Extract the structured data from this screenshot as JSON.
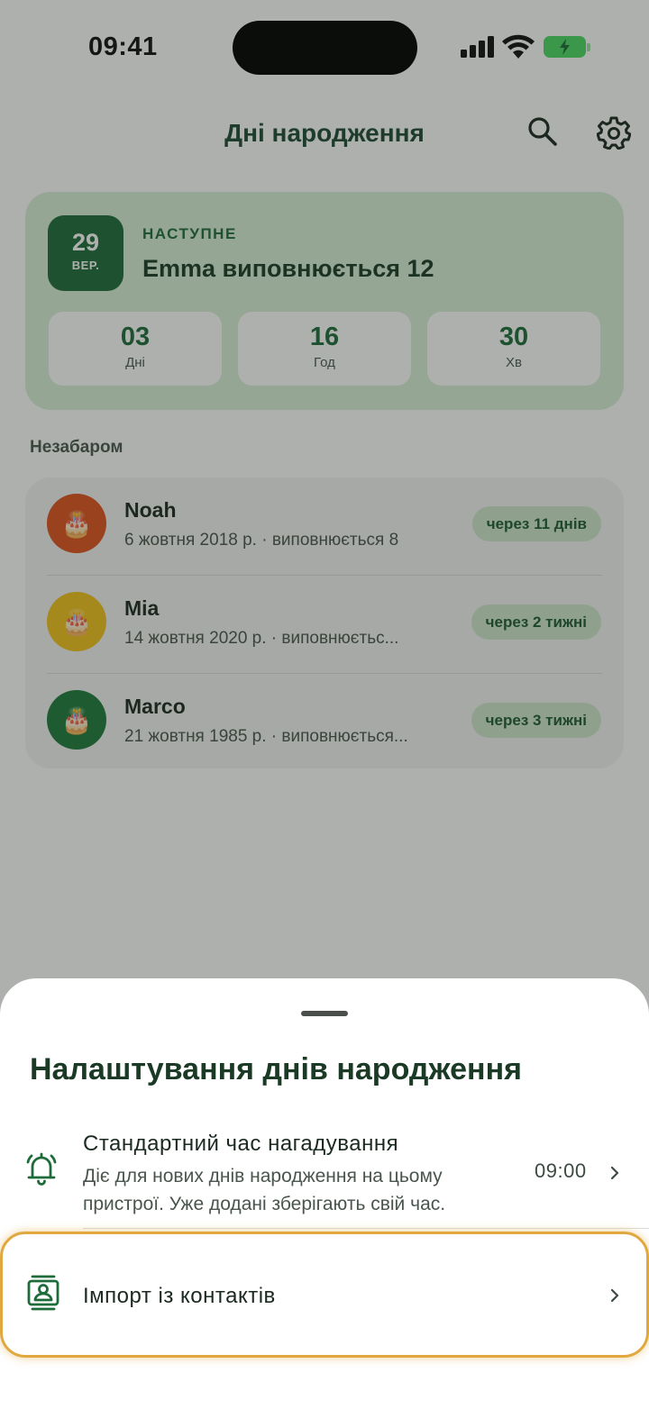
{
  "status_bar": {
    "time": "09:41"
  },
  "app_bar": {
    "title": "Дні народження"
  },
  "next_birthday": {
    "day": "29",
    "month": "ВЕР.",
    "label": "НАСТУПНЕ",
    "headline": "Emma виповнюється 12",
    "countdown": [
      {
        "value": "03",
        "unit": "Дні"
      },
      {
        "value": "16",
        "unit": "Год"
      },
      {
        "value": "30",
        "unit": "Хв"
      }
    ]
  },
  "upcoming": {
    "label": "Незабаром",
    "items": [
      {
        "name": "Noah",
        "detail": "6 жовтня 2018 р. · виповнюється 8",
        "badge": "через 11 днів",
        "avatar_color": "#e0521e",
        "icon": "birthday-cake-icon"
      },
      {
        "name": "Mia",
        "detail": "14 жовтня 2020 р. · виповнюєтьс...",
        "badge": "через 2 тижні",
        "avatar_color": "#f2c21c",
        "icon": "birthday-cake-icon"
      },
      {
        "name": "Marco",
        "detail": "21 жовтня 1985 р. · виповнюється...",
        "badge": "через 3 тижні",
        "avatar_color": "#1f7a3c",
        "icon": "birthday-cake-icon"
      }
    ]
  },
  "settings_sheet": {
    "title": "Налаштування днів народження",
    "reminder": {
      "label": "Стандартний час нагадування",
      "description": "Діє для нових днів народження на цьому пристрої. Уже додані зберігають свій час.",
      "value": "09:00",
      "icon": "bell-icon"
    },
    "import": {
      "label": "Імпорт із контактів",
      "icon": "contacts-icon"
    }
  },
  "colors": {
    "accent": "#1e6b3a",
    "card_bg": "#d9efd6",
    "highlight": "#e0a83e"
  }
}
